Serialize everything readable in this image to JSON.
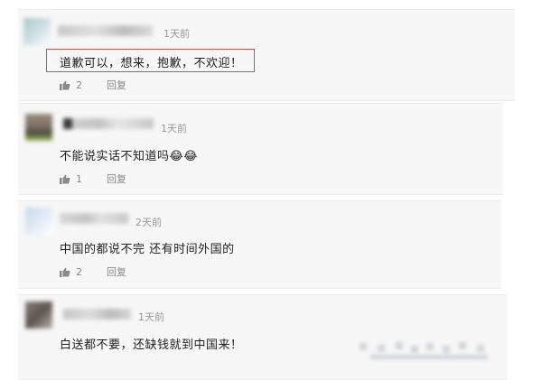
{
  "comments": [
    {
      "time": "1天前",
      "text": "道歉可以，想来，抱歉，不欢迎！",
      "likes": "2",
      "reply_label": "回复"
    },
    {
      "time": "1天前",
      "text": "不能说实话不知道吗😂😂",
      "likes": "1",
      "reply_label": "回复"
    },
    {
      "time": "2天前",
      "text": "中国的都说不完 还有时间外国的",
      "likes": "2",
      "reply_label": "回复"
    },
    {
      "time": "1天前",
      "text": "白送都不要，还缺钱就到中国来！"
    }
  ],
  "icons": {
    "like": "thumbs-up-icon"
  },
  "colors": {
    "highlight_border": "#b55a4f",
    "meta_text": "#8a8a8a",
    "card_bg": "#f7f7f7"
  }
}
